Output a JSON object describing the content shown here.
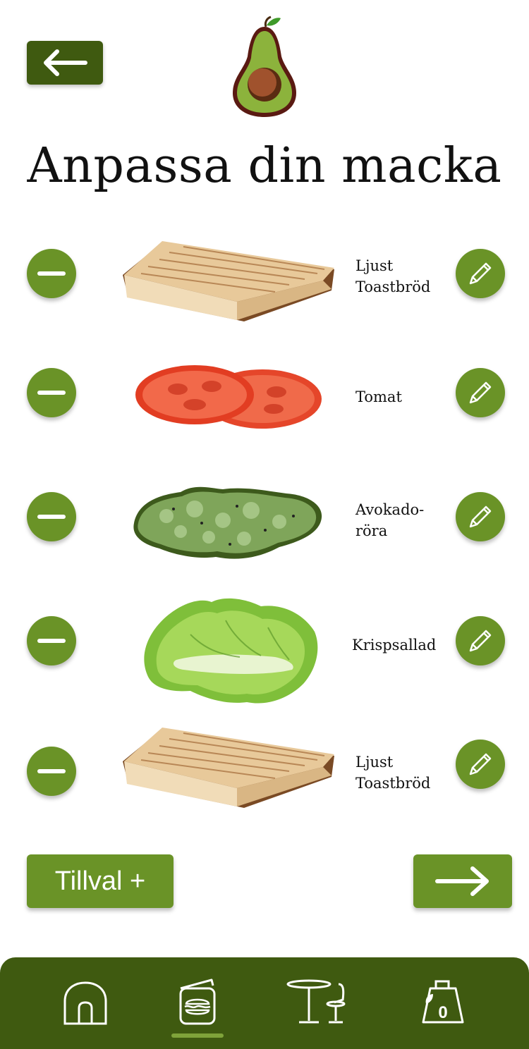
{
  "header": {
    "title": "Anpassa din macka"
  },
  "ingredients": [
    {
      "name": "Ljust Toastbröd",
      "image": "toast-bread",
      "minus_icon": "minus-icon",
      "edit_icon": "pencil-icon"
    },
    {
      "name": "Tomat",
      "image": "tomato-slices",
      "minus_icon": "minus-icon",
      "edit_icon": "pencil-icon"
    },
    {
      "name": "Avokado-röra",
      "image": "avocado-mash",
      "minus_icon": "minus-icon",
      "edit_icon": "pencil-icon"
    },
    {
      "name": "Krispsallad",
      "image": "lettuce",
      "minus_icon": "minus-icon",
      "edit_icon": "pencil-icon"
    },
    {
      "name": "Ljust Toastbröd",
      "image": "toast-bread",
      "minus_icon": "minus-icon",
      "edit_icon": "pencil-icon"
    }
  ],
  "actions": {
    "tillval_label": "Tillval +"
  },
  "nav": {
    "items": [
      {
        "icon": "home-icon"
      },
      {
        "icon": "sandwich-icon",
        "active": true
      },
      {
        "icon": "cafe-table-icon"
      },
      {
        "icon": "cart-bag-icon"
      }
    ],
    "cart_count": "0"
  },
  "colors": {
    "dark_green": "#3f5a10",
    "accent_green": "#6a9327",
    "indicator": "#7fa33a"
  }
}
